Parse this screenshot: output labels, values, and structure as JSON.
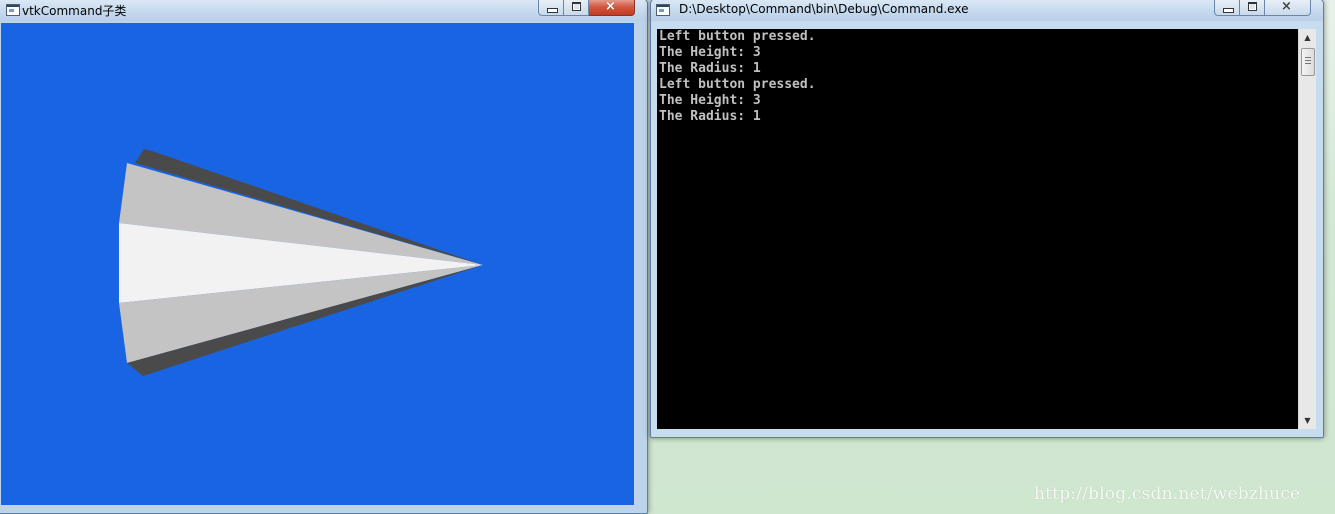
{
  "vtk_window": {
    "title": "vtkCommand子类",
    "background_color": "#1864e2",
    "buttons": {
      "minimize": "minimize",
      "maximize": "maximize",
      "close": "×"
    }
  },
  "console_window": {
    "title": "D:\\Desktop\\Command\\bin\\Debug\\Command.exe",
    "output_lines": [
      "Left button pressed.",
      "The Height: 3",
      "The Radius: 1",
      "Left button pressed.",
      "The Height: 3",
      "The Radius: 1"
    ],
    "buttons": {
      "minimize": "minimize",
      "maximize": "maximize",
      "close": "×"
    },
    "scroll_up": "▲",
    "scroll_down": "▼"
  },
  "watermark": "http://blog.csdn.net/webzhuce",
  "colors": {
    "cone_light": "#f2f2f2",
    "cone_mid": "#c4c4c4",
    "cone_dark": "#4a4a4a"
  },
  "icons": [
    "app-window-icon",
    "console-window-icon",
    "minimize-icon",
    "maximize-icon",
    "close-icon",
    "scroll-up-icon",
    "scroll-down-icon"
  ]
}
